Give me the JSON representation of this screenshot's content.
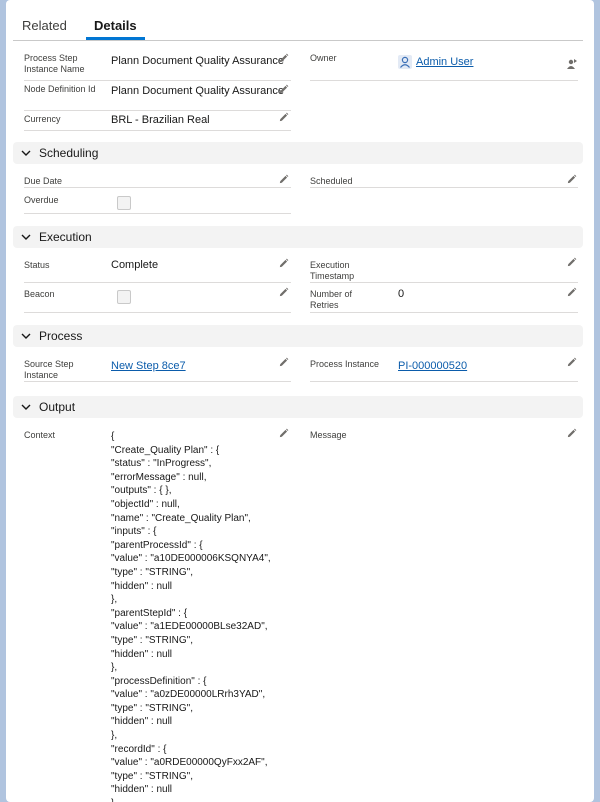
{
  "tabs": {
    "related": "Related",
    "details": "Details"
  },
  "fields": {
    "process_step_instance_name": {
      "label": "Process Step Instance Name",
      "value": "Plann Document Quality Assurance"
    },
    "owner": {
      "label": "Owner",
      "value": "Admin User"
    },
    "node_definition_id": {
      "label": "Node Definition Id",
      "value": "Plann Document Quality Assurance"
    },
    "currency": {
      "label": "Currency",
      "value": "BRL - Brazilian Real"
    },
    "due_date": {
      "label": "Due Date",
      "value": ""
    },
    "scheduled": {
      "label": "Scheduled",
      "value": ""
    },
    "overdue": {
      "label": "Overdue",
      "checked": false
    },
    "status": {
      "label": "Status",
      "value": "Complete"
    },
    "execution_timestamp": {
      "label": "Execution Timestamp",
      "value": ""
    },
    "beacon": {
      "label": "Beacon",
      "checked": false
    },
    "number_of_retries": {
      "label": "Number of Retries",
      "value": "0"
    },
    "source_step_instance": {
      "label": "Source Step Instance",
      "value": "New Step 8ce7"
    },
    "process_instance": {
      "label": "Process Instance",
      "value": "PI-000000520"
    },
    "context": {
      "label": "Context"
    },
    "message": {
      "label": "Message",
      "value": ""
    }
  },
  "sections": {
    "scheduling": "Scheduling",
    "execution": "Execution",
    "process": "Process",
    "output": "Output"
  },
  "context_lines": [
    "{",
    "\"Create_Quality Plan\" : {",
    "\"status\" : \"InProgress\",",
    "\"errorMessage\" : null,",
    "\"outputs\" : { },",
    "\"objectId\" : null,",
    "\"name\" : \"Create_Quality Plan\",",
    "\"inputs\" : {",
    "\"parentProcessId\" : {",
    "\"value\" : \"a10DE000006KSQNYA4\",",
    "\"type\" : \"STRING\",",
    "\"hidden\" : null",
    "},",
    "\"parentStepId\" : {",
    "\"value\" : \"a1EDE00000BLse32AD\",",
    "\"type\" : \"STRING\",",
    "\"hidden\" : null",
    "},",
    "\"processDefinition\" : {",
    "\"value\" : \"a0zDE00000LRrh3YAD\",",
    "\"type\" : \"STRING\",",
    "\"hidden\" : null",
    "},",
    "\"recordId\" : {",
    "\"value\" : \"a0RDE00000QyFxx2AF\",",
    "\"type\" : \"STRING\",",
    "\"hidden\" : null",
    "}"
  ],
  "icons": {
    "edit": "pencil-icon",
    "section_toggle": "chevron-down-icon",
    "owner_avatar": "user-avatar-icon",
    "change_owner": "change-owner-icon"
  },
  "colors": {
    "link": "#0b5cab",
    "tab_active": "#0176d3",
    "section_bg": "#f3f3f3"
  }
}
